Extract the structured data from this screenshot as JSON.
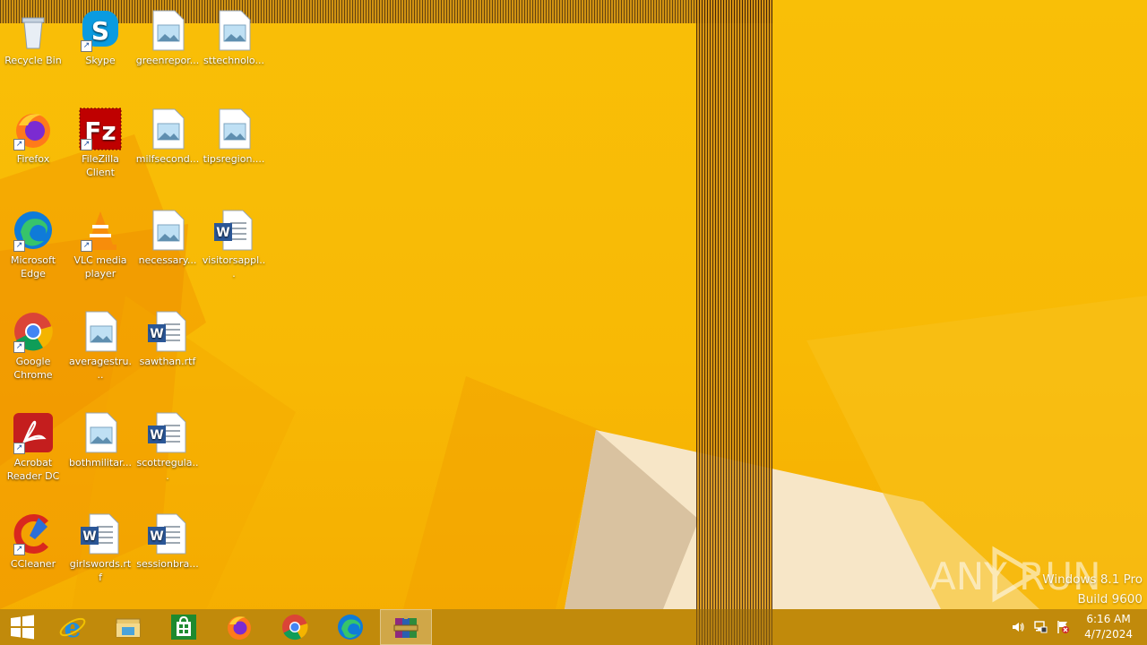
{
  "desktop": {
    "icons": [
      {
        "label": "Recycle Bin",
        "icon": "recycle-bin-icon"
      },
      {
        "label": "Skype",
        "icon": "skype-icon"
      },
      {
        "label": "greenrepor...",
        "icon": "image-file-icon"
      },
      {
        "label": "sttechnolo...",
        "icon": "image-file-icon"
      },
      {
        "label": "Firefox",
        "icon": "firefox-icon"
      },
      {
        "label": "FileZilla Client",
        "icon": "filezilla-icon"
      },
      {
        "label": "milfsecond...",
        "icon": "image-file-icon"
      },
      {
        "label": "tipsregion....",
        "icon": "image-file-icon"
      },
      {
        "label": "Microsoft Edge",
        "icon": "edge-icon"
      },
      {
        "label": "VLC media player",
        "icon": "vlc-icon"
      },
      {
        "label": "necessary...",
        "icon": "image-file-icon"
      },
      {
        "label": "visitorsappl...",
        "icon": "word-document-icon"
      },
      {
        "label": "Google Chrome",
        "icon": "chrome-icon"
      },
      {
        "label": "averagestru...",
        "icon": "image-file-icon"
      },
      {
        "label": "sawthan.rtf",
        "icon": "word-document-icon"
      },
      {
        "label": "Acrobat Reader DC",
        "icon": "acrobat-icon"
      },
      {
        "label": "bothmilitar...",
        "icon": "image-file-icon"
      },
      {
        "label": "scottregula...",
        "icon": "word-document-icon"
      },
      {
        "label": "CCleaner",
        "icon": "ccleaner-icon"
      },
      {
        "label": "girlswords.rtf",
        "icon": "word-document-icon"
      },
      {
        "label": "sessionbra...",
        "icon": "word-document-icon"
      }
    ]
  },
  "watermark": {
    "text": "ANY RUN"
  },
  "os": {
    "edition": "Windows 8.1 Pro",
    "build": "Build 9600"
  },
  "taskbar": {
    "buttons": [
      {
        "name": "start-button",
        "icon": "windows-logo-icon"
      },
      {
        "name": "internet-explorer",
        "icon": "internet-explorer-icon"
      },
      {
        "name": "file-explorer",
        "icon": "file-explorer-icon"
      },
      {
        "name": "store",
        "icon": "store-icon"
      },
      {
        "name": "firefox",
        "icon": "firefox-icon"
      },
      {
        "name": "chrome",
        "icon": "chrome-icon"
      },
      {
        "name": "edge",
        "icon": "edge-icon"
      },
      {
        "name": "winrar",
        "icon": "winrar-icon",
        "active": true
      }
    ],
    "tray": {
      "icons": [
        "volume-icon",
        "network-icon",
        "action-center-flag-icon"
      ]
    },
    "clock": {
      "time": "6:16 AM",
      "date": "4/7/2024"
    }
  },
  "colors": {
    "wallpaper": "#f8b905",
    "taskbar": "#96701a",
    "accent_red": "#c41e1e"
  }
}
